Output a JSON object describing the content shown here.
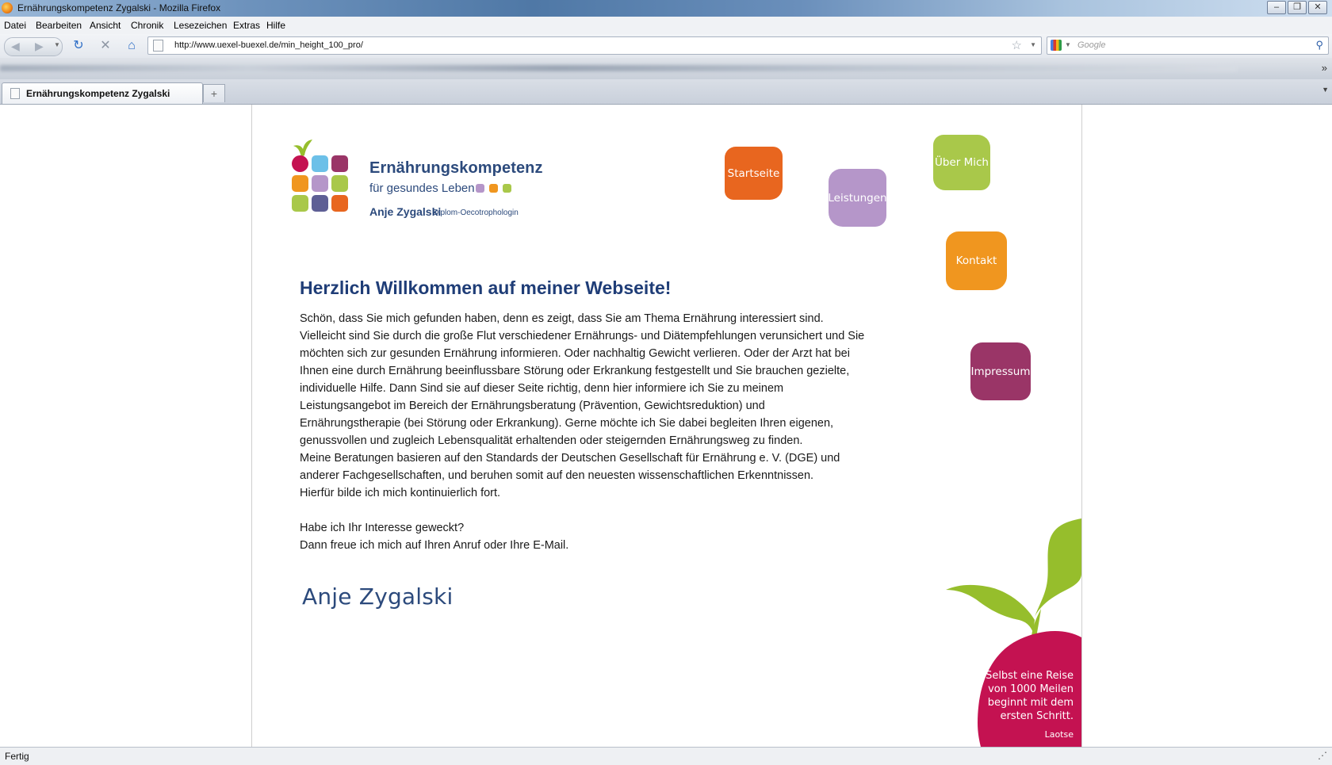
{
  "window": {
    "title": "Ernährungskompetenz Zygalski - Mozilla Firefox"
  },
  "menu": [
    "Datei",
    "Bearbeiten",
    "Ansicht",
    "Chronik",
    "Lesezeichen",
    "Extras",
    "Hilfe"
  ],
  "navbar": {
    "url": "http://www.uexel-buexel.de/min_height_100_pro/",
    "search_placeholder": "Google"
  },
  "tab": {
    "label": "Ernährungskompetenz Zygalski"
  },
  "status": {
    "text": "Fertig"
  },
  "logo": {
    "brand": "Ernährungskompetenz",
    "tagline": "für gesundes Leben",
    "name": "Anje Zygalski",
    "degree": "Diplom-Oecotrophologin"
  },
  "nav": {
    "start": "Startseite",
    "services": "Leistungen",
    "about": "Über Mich",
    "contact": "Kontakt",
    "imprint": "Impressum"
  },
  "colors": {
    "orange_red": "#e8661f",
    "lavender": "#b596c9",
    "lime": "#a9c84a",
    "orange": "#f0961f",
    "plum": "#9a3567",
    "raspberry": "#c41251",
    "leaf": "#96be2c",
    "heading": "#1f3d77"
  },
  "content": {
    "heading": "Herzlich Willkommen auf meiner Webseite!",
    "lines": [
      "Schön, dass Sie mich gefunden haben, denn es zeigt, dass Sie am Thema Ernährung interessiert sind.",
      "Vielleicht sind Sie durch die große Flut verschiedener Ernährungs- und Diätempfehlungen verunsichert und Sie",
      "möchten sich zur gesunden Ernährung informieren. Oder nachhaltig Gewicht verlieren. Oder der Arzt hat bei",
      "Ihnen eine durch Ernährung beeinflussbare Störung oder Erkrankung festgestellt und Sie brauchen gezielte,",
      "individuelle Hilfe. Dann Sind sie auf dieser Seite richtig, denn hier informiere ich Sie zu meinem",
      "Leistungsangebot im Bereich der Ernährungsberatung (Prävention, Gewichtsreduktion) und",
      "Ernährungstherapie (bei Störung oder Erkrankung). Gerne möchte ich Sie dabei begleiten Ihren eigenen,",
      "genussvollen und zugleich Lebensqualität erhaltenden oder steigernden Ernährungsweg zu finden.",
      "Meine Beratungen basieren auf den Standards der Deutschen Gesellschaft für Ernährung e. V. (DGE) und",
      "anderer Fachgesellschaften, und beruhen somit auf den neuesten wissenschaftlichen Erkenntnissen.",
      "Hierfür bilde ich mich kontinuierlich fort."
    ],
    "closing": [
      "Habe ich Ihr Interesse geweckt?",
      "Dann freue ich mich auf Ihren Anruf oder Ihre E-Mail."
    ],
    "signature": "Anje Zygalski"
  },
  "quote": {
    "lines": [
      "Selbst eine Reise",
      "von 1000 Meilen",
      "beginnt mit dem",
      "ersten Schritt."
    ],
    "author": "Laotse"
  }
}
